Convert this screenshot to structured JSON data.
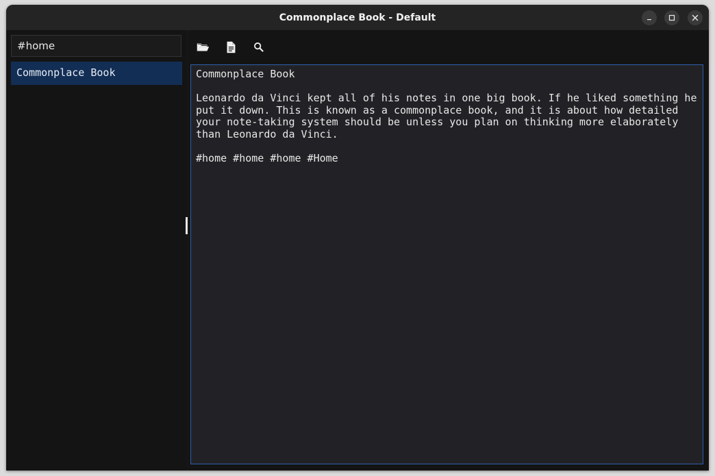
{
  "window": {
    "title": "Commonplace Book - Default",
    "controls": [
      "minimize-icon",
      "maximize-icon",
      "close-icon"
    ]
  },
  "sidebar": {
    "search": {
      "value": "#home",
      "placeholder": ""
    },
    "notes": [
      {
        "label": "Commonplace Book",
        "selected": true
      }
    ]
  },
  "toolbar": {
    "icons": [
      "folder-open-icon",
      "document-icon",
      "search-icon"
    ]
  },
  "editor": {
    "title_line": "Commonplace Book",
    "body": "Leonardo da Vinci kept all of his notes in one big book. If he liked something he put it down. This is known as a commonplace book, and it is about how detailed your note-taking system should be unless you plan on thinking more elaborately than Leonardo da Vinci.",
    "tags_line": "#home #home #home #Home"
  },
  "colors": {
    "selection": "#132e55",
    "editor_border": "#2f5fae",
    "editor_bg": "#222226",
    "sidebar_bg": "#141414",
    "titlebar_bg": "#242424"
  }
}
